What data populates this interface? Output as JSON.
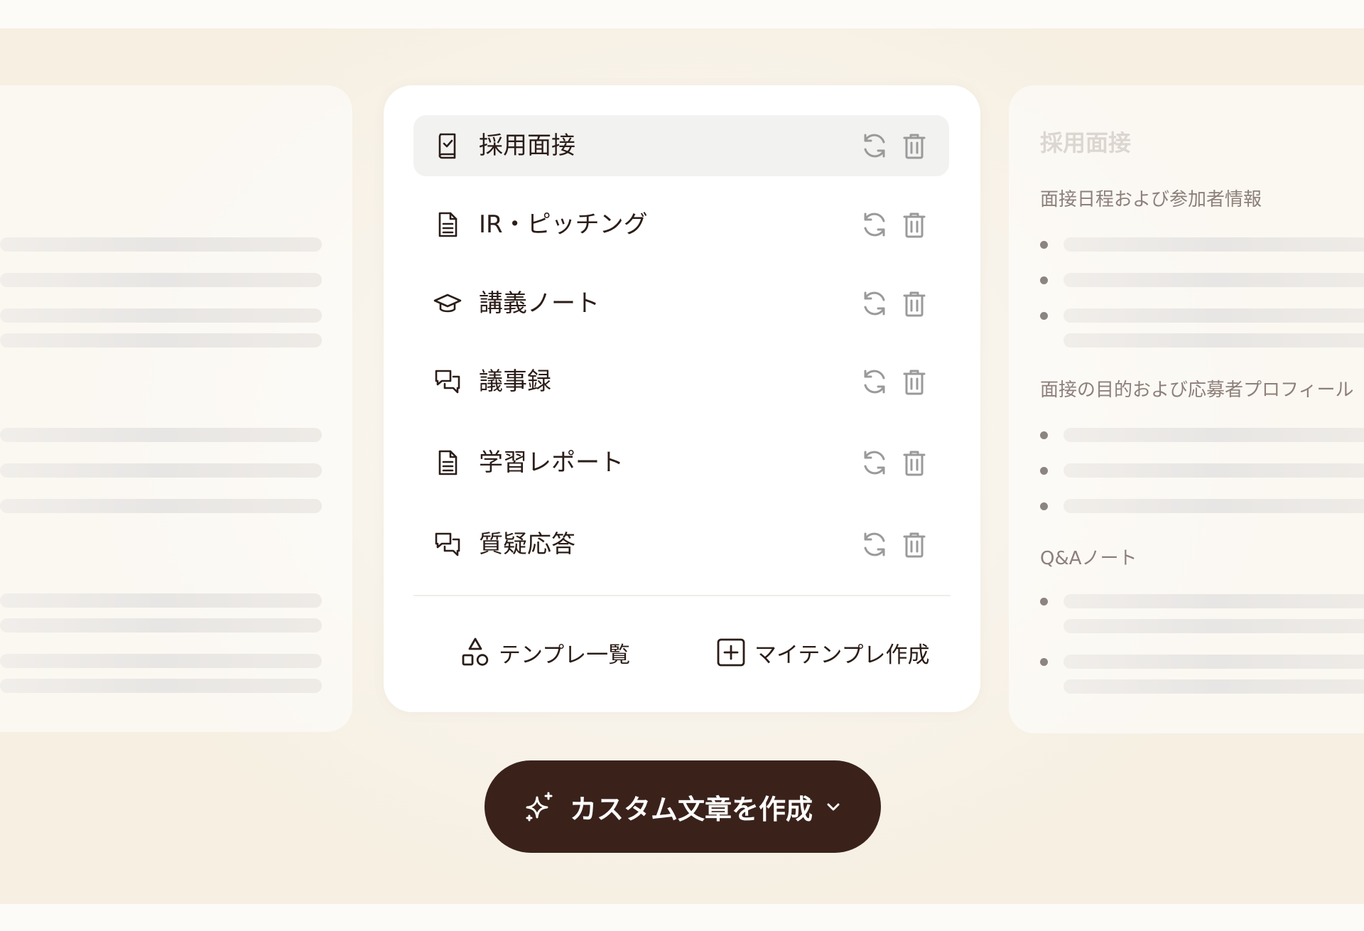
{
  "templates": [
    {
      "label": "採用面接",
      "icon": "checklist-book-icon",
      "active": true
    },
    {
      "label": "IR・ピッチング",
      "icon": "document-icon",
      "active": false
    },
    {
      "label": "講義ノート",
      "icon": "graduation-cap-icon",
      "active": false
    },
    {
      "label": "議事録",
      "icon": "chat-bubbles-icon",
      "active": false
    },
    {
      "label": "学習レポート",
      "icon": "document-icon",
      "active": false
    },
    {
      "label": "質疑応答",
      "icon": "chat-bubbles-icon",
      "active": false
    }
  ],
  "footer": {
    "template_list_label": "テンプレ一覧",
    "create_template_label": "マイテンプレ作成"
  },
  "cta": {
    "label": "カスタム文章を作成"
  },
  "preview": {
    "title": "採用面接",
    "sections": [
      "面接日程および参加者情報",
      "面接の目的および応募者プロフィール",
      "Q&Aノート"
    ]
  },
  "colors": {
    "brand_dark": "#3a221b",
    "text": "#2b1d18",
    "active_row": "#f2f2f1",
    "muted_icon": "#9a9a9a"
  }
}
